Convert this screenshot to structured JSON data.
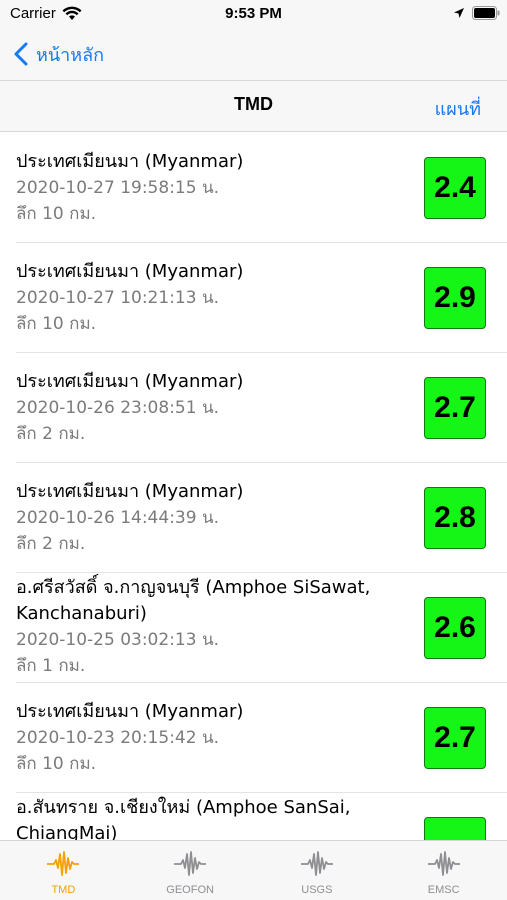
{
  "status_bar": {
    "carrier": "Carrier",
    "time": "9:53 PM"
  },
  "nav": {
    "back_label": "หน้าหลัก"
  },
  "header": {
    "title": "TMD",
    "map_label": "แผนที่"
  },
  "colors": {
    "accent": "#1479f5",
    "magnitude_bg": "#16f616",
    "tab_active": "#f5a100",
    "tab_inactive": "#8e8e93"
  },
  "quakes": [
    {
      "place": "ประเทศเมียนมา (Myanmar)",
      "datetime": "2020-10-27 19:58:15 น.",
      "depth": "ลึก 10 กม.",
      "magnitude": "2.4"
    },
    {
      "place": "ประเทศเมียนมา (Myanmar)",
      "datetime": "2020-10-27 10:21:13 น.",
      "depth": "ลึก 10 กม.",
      "magnitude": "2.9"
    },
    {
      "place": "ประเทศเมียนมา (Myanmar)",
      "datetime": "2020-10-26 23:08:51 น.",
      "depth": "ลึก 2 กม.",
      "magnitude": "2.7"
    },
    {
      "place": "ประเทศเมียนมา (Myanmar)",
      "datetime": "2020-10-26 14:44:39 น.",
      "depth": "ลึก 2 กม.",
      "magnitude": "2.8"
    },
    {
      "place": "อ.ศรีสวัสดิ์ จ.กาญจนบุรี (Amphoe SiSawat, Kanchanaburi)",
      "datetime": "2020-10-25 03:02:13 น.",
      "depth": "ลึก 1 กม.",
      "magnitude": "2.6"
    },
    {
      "place": "ประเทศเมียนมา (Myanmar)",
      "datetime": "2020-10-23 20:15:42 น.",
      "depth": "ลึก 10 กม.",
      "magnitude": "2.7"
    },
    {
      "place": "อ.สันทราย จ.เชียงใหม่ (Amphoe SanSai, ChiangMai)",
      "datetime": "",
      "depth": "",
      "magnitude": ""
    }
  ],
  "tabs": [
    {
      "label": "TMD",
      "icon": "seismograph-icon",
      "active": true
    },
    {
      "label": "GEOFON",
      "icon": "seismograph-icon",
      "active": false
    },
    {
      "label": "USGS",
      "icon": "seismograph-icon",
      "active": false
    },
    {
      "label": "EMSC",
      "icon": "seismograph-icon",
      "active": false
    }
  ]
}
